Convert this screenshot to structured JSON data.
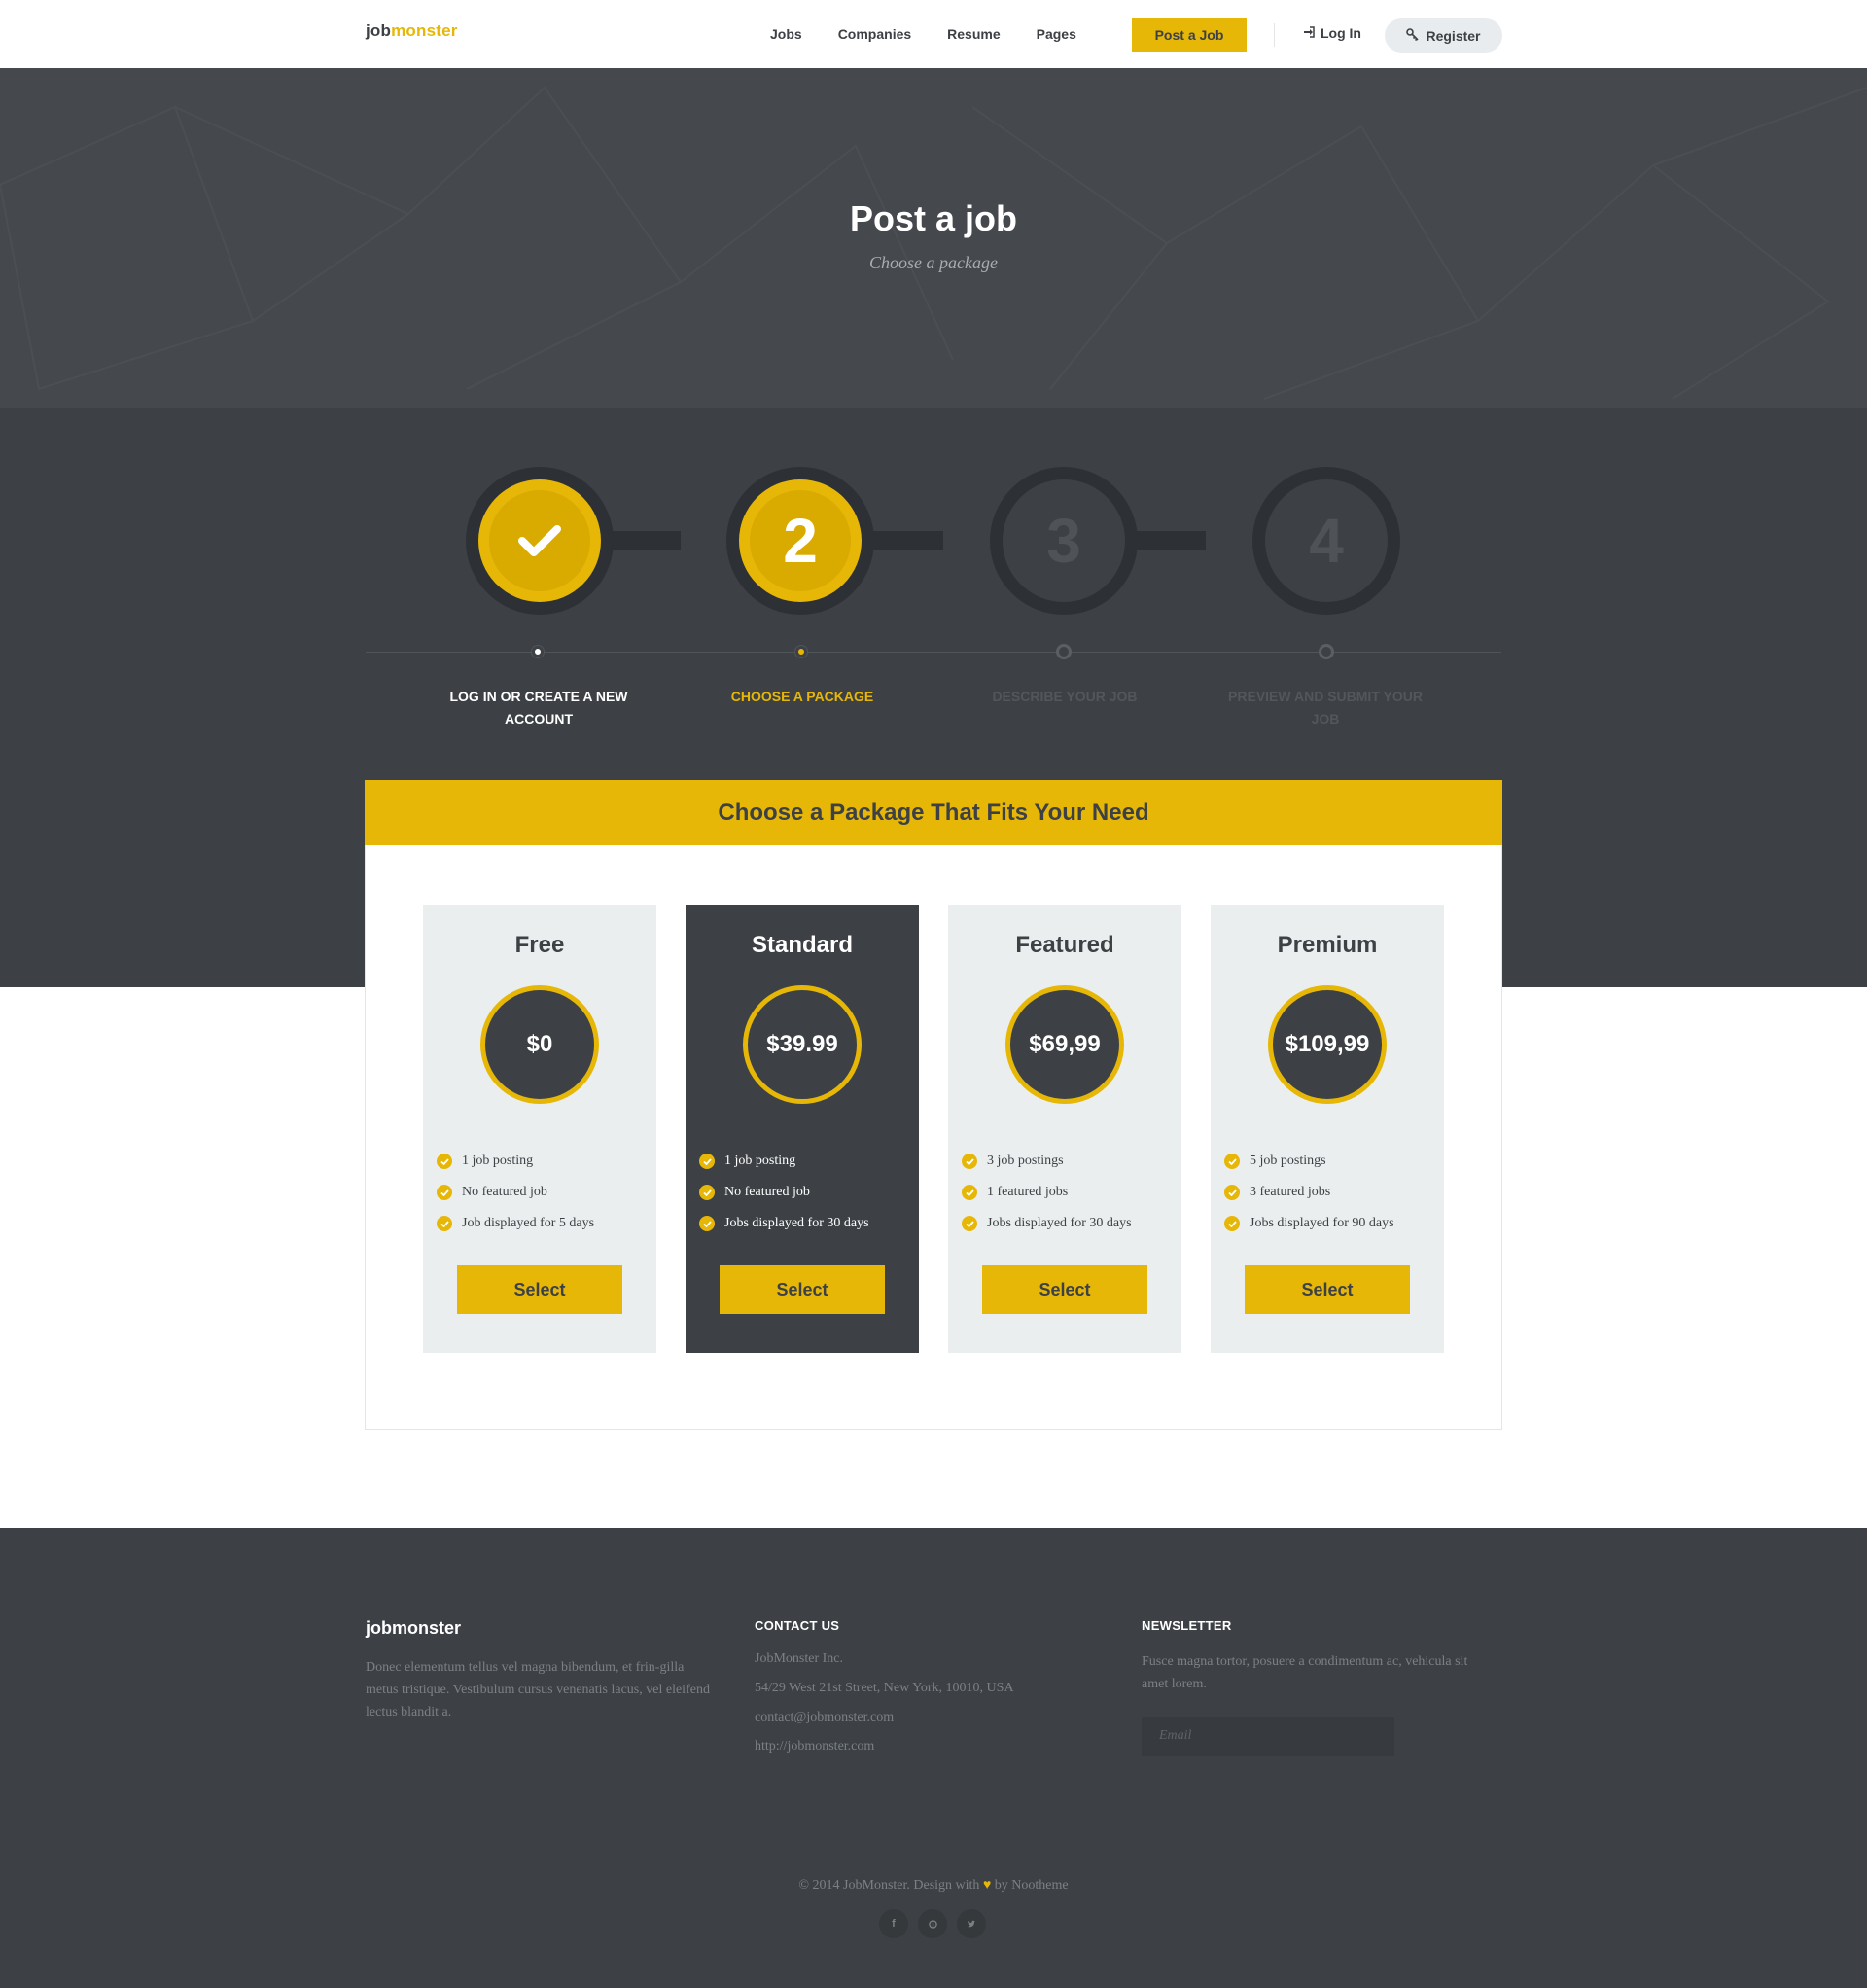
{
  "header": {
    "logo_prefix": "job",
    "logo_accent": "monster",
    "nav": [
      "Jobs",
      "Companies",
      "Resume",
      "Pages"
    ],
    "post_job": "Post a Job",
    "login": "Log In",
    "register": "Register"
  },
  "hero": {
    "title": "Post a job",
    "subtitle": "Choose a package"
  },
  "steps": [
    {
      "number": "✓",
      "label": "LOG IN OR CREATE A NEW ACCOUNT",
      "state": "done"
    },
    {
      "number": "2",
      "label": "CHOOSE A PACKAGE",
      "state": "current"
    },
    {
      "number": "3",
      "label": "DESCRIBE YOUR JOB",
      "state": "todo"
    },
    {
      "number": "4",
      "label": "PREVIEW AND SUBMIT YOUR JOB",
      "state": "todo"
    }
  ],
  "packages_heading": "Choose a Package That Fits Your Need",
  "packages": [
    {
      "name": "Free",
      "price": "$0",
      "features": [
        "1 job posting",
        "No featured job",
        "Job displayed for 5 days"
      ],
      "button": "Select"
    },
    {
      "name": "Standard",
      "price": "$39.99",
      "features": [
        "1 job posting",
        "No featured job",
        "Jobs displayed for 30 days"
      ],
      "button": "Select"
    },
    {
      "name": "Featured",
      "price": "$69,99",
      "features": [
        "3 job postings",
        "1 featured jobs",
        "Jobs displayed for 30 days"
      ],
      "button": "Select"
    },
    {
      "name": "Premium",
      "price": "$109,99",
      "features": [
        "5 job postings",
        "3 featured jobs",
        "Jobs displayed for 90 days"
      ],
      "button": "Select"
    }
  ],
  "footer": {
    "about_title": "jobmonster",
    "about_text": "Donec elementum tellus vel magna bibendum, et frin-gilla metus tristique. Vestibulum cursus venenatis lacus, vel eleifend lectus blandit a.",
    "contact_title": "CONTACT US",
    "contact_lines": [
      "JobMonster Inc.",
      "54/29 West 21st Street, New York, 10010, USA",
      "contact@jobmonster.com",
      "http://jobmonster.com"
    ],
    "newsletter_title": "NEWSLETTER",
    "newsletter_text": "Fusce magna tortor, posuere a condimentum ac, vehicula sit amet lorem.",
    "email_placeholder": "Email",
    "copyright_prefix": "© 2014 JobMonster. Design with",
    "copyright_suffix": "by Nootheme",
    "socials": [
      "facebook-icon",
      "pinterest-icon",
      "twitter-icon"
    ]
  },
  "colors": {
    "accent": "#e6b707",
    "dark": "#3d4145",
    "darker": "#2d3034"
  }
}
